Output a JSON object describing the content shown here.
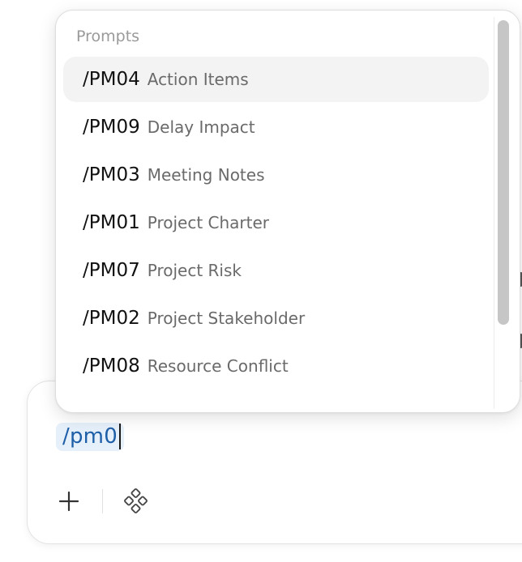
{
  "popup": {
    "header": "Prompts",
    "items": [
      {
        "command": "/PM04",
        "description": "Action Items",
        "active": true
      },
      {
        "command": "/PM09",
        "description": "Delay Impact",
        "active": false
      },
      {
        "command": "/PM03",
        "description": "Meeting Notes",
        "active": false
      },
      {
        "command": "/PM01",
        "description": "Project Charter",
        "active": false
      },
      {
        "command": "/PM07",
        "description": "Project Risk",
        "active": false
      },
      {
        "command": "/PM02",
        "description": "Project Stakeholder",
        "active": false
      },
      {
        "command": "/PM08",
        "description": "Resource Conflict",
        "active": false
      }
    ]
  },
  "composer": {
    "input_value": "/pm0",
    "tools": [
      {
        "icon": "plus-icon"
      },
      {
        "icon": "tools-diamond-icon"
      }
    ]
  },
  "colors": {
    "token_bg": "#e6f0fb",
    "token_text": "#1f5fa8",
    "active_row": "#f3f3f3",
    "scroll_thumb": "#c6c6c6"
  }
}
